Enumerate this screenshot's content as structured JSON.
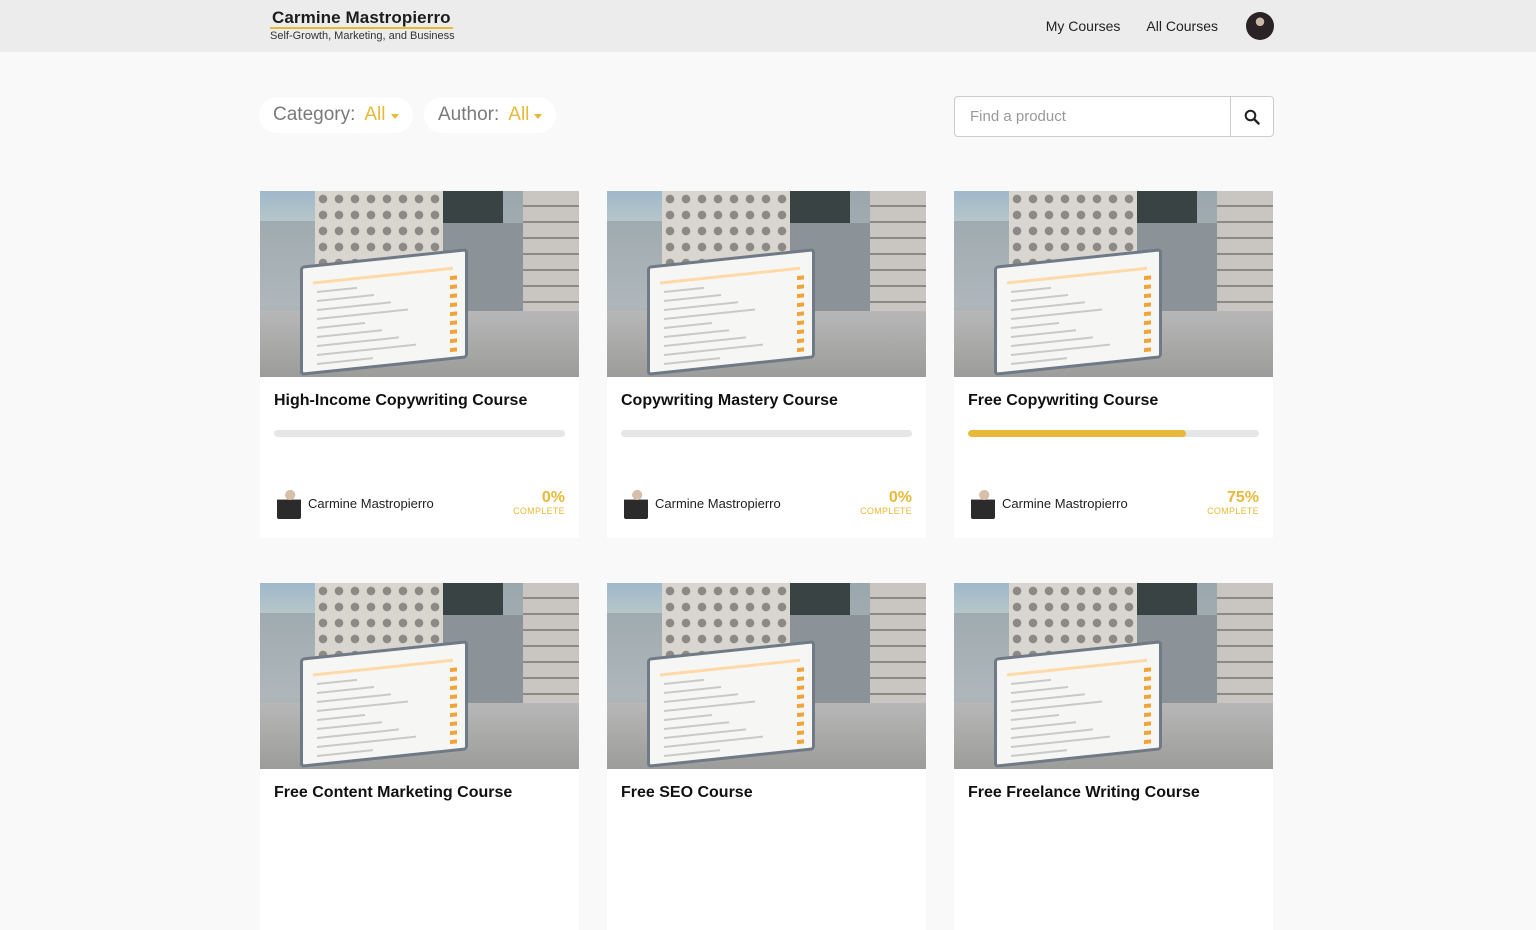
{
  "header": {
    "brand_name": "Carmine Mastropierro",
    "brand_tagline": "Self-Growth, Marketing, and Business",
    "nav": [
      "My Courses",
      "All Courses"
    ]
  },
  "filters": {
    "category_label": "Category:",
    "category_value": "All",
    "author_label": "Author:",
    "author_value": "All"
  },
  "search": {
    "placeholder": "Find a product"
  },
  "accent_color": "#e8b838",
  "courses": [
    {
      "title": "High-Income Copywriting Course",
      "author": "Carmine Mastropierro",
      "progress": 0,
      "percent_text": "0%",
      "complete_label": "COMPLETE"
    },
    {
      "title": "Copywriting Mastery Course",
      "author": "Carmine Mastropierro",
      "progress": 0,
      "percent_text": "0%",
      "complete_label": "COMPLETE"
    },
    {
      "title": "Free Copywriting Course",
      "author": "Carmine Mastropierro",
      "progress": 75,
      "percent_text": "75%",
      "complete_label": "COMPLETE"
    },
    {
      "title": "Free Content Marketing Course"
    },
    {
      "title": "Free SEO Course"
    },
    {
      "title": "Free Freelance Writing Course"
    }
  ]
}
